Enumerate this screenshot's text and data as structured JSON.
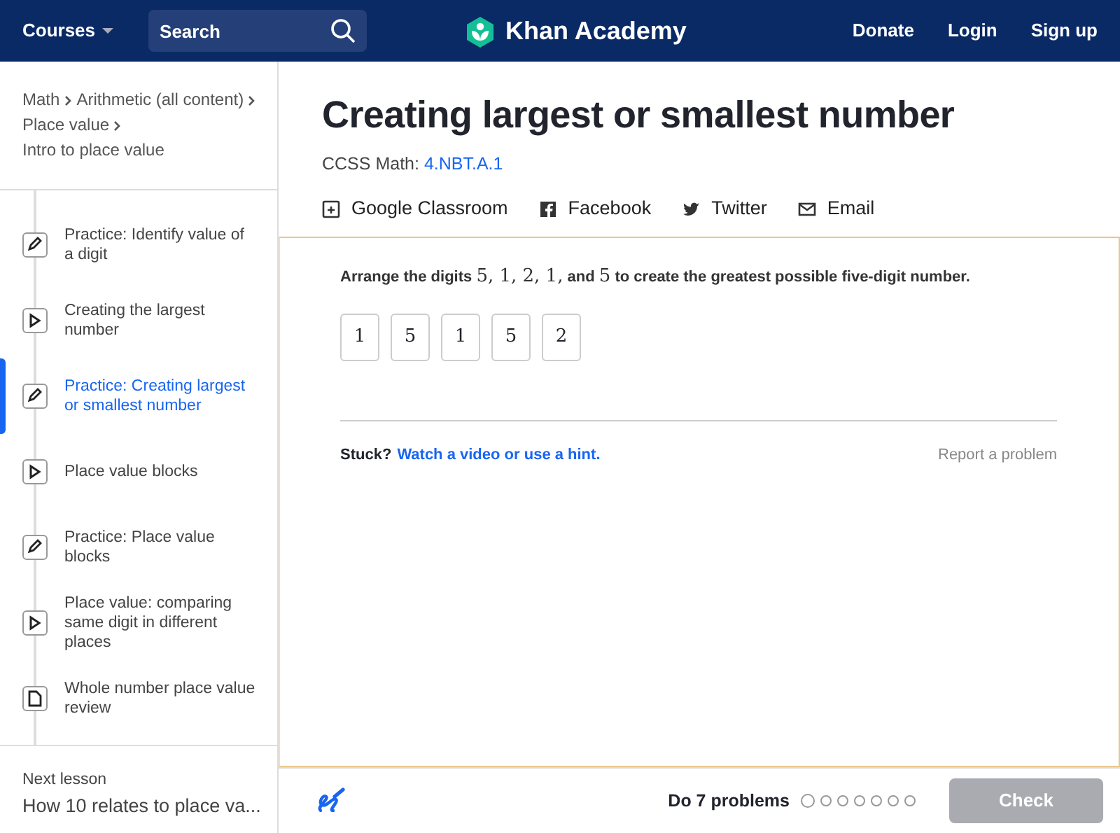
{
  "navbar": {
    "courses": "Courses",
    "search": {
      "placeholder": "Search"
    },
    "logo": "Khan Academy",
    "links": [
      "Donate",
      "Login",
      "Sign up"
    ]
  },
  "breadcrumb": [
    "Math",
    "Arithmetic (all content)",
    "Place value",
    "Intro to place value"
  ],
  "lessons": [
    {
      "kind": "exercise",
      "title": "Practice: Identify value of a digit",
      "selected": false
    },
    {
      "kind": "video",
      "title": "Creating the largest number",
      "selected": false
    },
    {
      "kind": "exercise",
      "title": "Practice: Creating largest or smallest number",
      "selected": true
    },
    {
      "kind": "video",
      "title": "Place value blocks",
      "selected": false
    },
    {
      "kind": "exercise",
      "title": "Practice: Place value blocks",
      "selected": false
    },
    {
      "kind": "video",
      "title": "Place value: comparing same digit in different places",
      "selected": false
    },
    {
      "kind": "article",
      "title": "Whole number place value review",
      "selected": false
    }
  ],
  "next_lesson": {
    "label": "Next lesson",
    "title": "How 10 relates to place va..."
  },
  "title": "Creating largest or smallest number",
  "standard": {
    "label": "CCSS Math:",
    "code": "4.NBT.A.1"
  },
  "share": [
    {
      "kind": "classroom",
      "label": "Google Classroom"
    },
    {
      "kind": "facebook",
      "label": "Facebook"
    },
    {
      "kind": "twitter",
      "label": "Twitter"
    },
    {
      "kind": "email",
      "label": "Email"
    }
  ],
  "problem": [
    {
      "kind": "text",
      "text": "Arrange the digits"
    },
    {
      "kind": "math",
      "text": "5, 1, 2, 1,"
    },
    {
      "kind": "text",
      "text": "and"
    },
    {
      "kind": "math",
      "text": "5"
    },
    {
      "kind": "text",
      "text": "to create the greatest possible five-digit number."
    }
  ],
  "tiles": [
    "1",
    "5",
    "1",
    "5",
    "2"
  ],
  "stuck": {
    "label": "Stuck?",
    "link": "Watch a video or use a hint.",
    "report": "Report a problem"
  },
  "footer": {
    "goal": "Do 7 problems",
    "problems": [
      {
        "selected": true
      },
      {
        "selected": false
      },
      {
        "selected": false
      },
      {
        "selected": false
      },
      {
        "selected": false
      },
      {
        "selected": false
      },
      {
        "selected": false
      }
    ],
    "check": {
      "label": "Check",
      "disabled": true
    }
  }
}
